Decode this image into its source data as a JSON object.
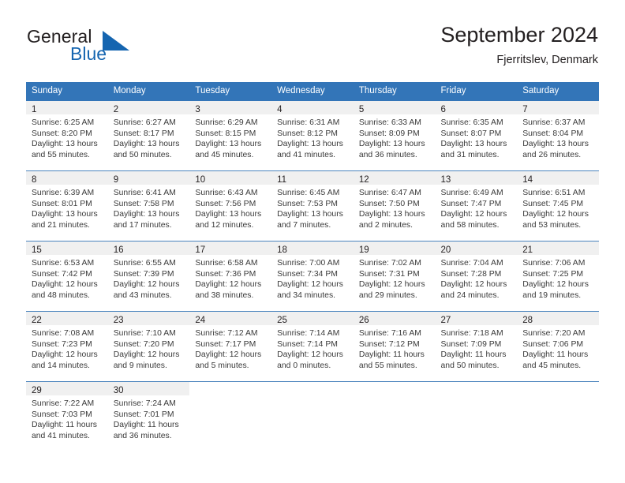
{
  "brand": {
    "word1": "General",
    "word2": "Blue",
    "triangle_color": "#1565b0",
    "icon": "blue-triangle-icon"
  },
  "header": {
    "title": "September 2024",
    "location": "Fjerritslev, Denmark"
  },
  "theme": {
    "header_blue": "#3375b8",
    "row_divider": "#4a84bd",
    "daynum_band": "#f0f0f0",
    "text": "#231f20"
  },
  "calendar": {
    "weekday_headers": [
      "Sunday",
      "Monday",
      "Tuesday",
      "Wednesday",
      "Thursday",
      "Friday",
      "Saturday"
    ],
    "labels": {
      "sunrise": "Sunrise:",
      "sunset": "Sunset:",
      "daylight": "Daylight:"
    },
    "weeks": [
      [
        {
          "day": "1",
          "sunrise": "Sunrise: 6:25 AM",
          "sunset": "Sunset: 8:20 PM",
          "daylight_1": "Daylight: 13 hours",
          "daylight_2": "and 55 minutes."
        },
        {
          "day": "2",
          "sunrise": "Sunrise: 6:27 AM",
          "sunset": "Sunset: 8:17 PM",
          "daylight_1": "Daylight: 13 hours",
          "daylight_2": "and 50 minutes."
        },
        {
          "day": "3",
          "sunrise": "Sunrise: 6:29 AM",
          "sunset": "Sunset: 8:15 PM",
          "daylight_1": "Daylight: 13 hours",
          "daylight_2": "and 45 minutes."
        },
        {
          "day": "4",
          "sunrise": "Sunrise: 6:31 AM",
          "sunset": "Sunset: 8:12 PM",
          "daylight_1": "Daylight: 13 hours",
          "daylight_2": "and 41 minutes."
        },
        {
          "day": "5",
          "sunrise": "Sunrise: 6:33 AM",
          "sunset": "Sunset: 8:09 PM",
          "daylight_1": "Daylight: 13 hours",
          "daylight_2": "and 36 minutes."
        },
        {
          "day": "6",
          "sunrise": "Sunrise: 6:35 AM",
          "sunset": "Sunset: 8:07 PM",
          "daylight_1": "Daylight: 13 hours",
          "daylight_2": "and 31 minutes."
        },
        {
          "day": "7",
          "sunrise": "Sunrise: 6:37 AM",
          "sunset": "Sunset: 8:04 PM",
          "daylight_1": "Daylight: 13 hours",
          "daylight_2": "and 26 minutes."
        }
      ],
      [
        {
          "day": "8",
          "sunrise": "Sunrise: 6:39 AM",
          "sunset": "Sunset: 8:01 PM",
          "daylight_1": "Daylight: 13 hours",
          "daylight_2": "and 21 minutes."
        },
        {
          "day": "9",
          "sunrise": "Sunrise: 6:41 AM",
          "sunset": "Sunset: 7:58 PM",
          "daylight_1": "Daylight: 13 hours",
          "daylight_2": "and 17 minutes."
        },
        {
          "day": "10",
          "sunrise": "Sunrise: 6:43 AM",
          "sunset": "Sunset: 7:56 PM",
          "daylight_1": "Daylight: 13 hours",
          "daylight_2": "and 12 minutes."
        },
        {
          "day": "11",
          "sunrise": "Sunrise: 6:45 AM",
          "sunset": "Sunset: 7:53 PM",
          "daylight_1": "Daylight: 13 hours",
          "daylight_2": "and 7 minutes."
        },
        {
          "day": "12",
          "sunrise": "Sunrise: 6:47 AM",
          "sunset": "Sunset: 7:50 PM",
          "daylight_1": "Daylight: 13 hours",
          "daylight_2": "and 2 minutes."
        },
        {
          "day": "13",
          "sunrise": "Sunrise: 6:49 AM",
          "sunset": "Sunset: 7:47 PM",
          "daylight_1": "Daylight: 12 hours",
          "daylight_2": "and 58 minutes."
        },
        {
          "day": "14",
          "sunrise": "Sunrise: 6:51 AM",
          "sunset": "Sunset: 7:45 PM",
          "daylight_1": "Daylight: 12 hours",
          "daylight_2": "and 53 minutes."
        }
      ],
      [
        {
          "day": "15",
          "sunrise": "Sunrise: 6:53 AM",
          "sunset": "Sunset: 7:42 PM",
          "daylight_1": "Daylight: 12 hours",
          "daylight_2": "and 48 minutes."
        },
        {
          "day": "16",
          "sunrise": "Sunrise: 6:55 AM",
          "sunset": "Sunset: 7:39 PM",
          "daylight_1": "Daylight: 12 hours",
          "daylight_2": "and 43 minutes."
        },
        {
          "day": "17",
          "sunrise": "Sunrise: 6:58 AM",
          "sunset": "Sunset: 7:36 PM",
          "daylight_1": "Daylight: 12 hours",
          "daylight_2": "and 38 minutes."
        },
        {
          "day": "18",
          "sunrise": "Sunrise: 7:00 AM",
          "sunset": "Sunset: 7:34 PM",
          "daylight_1": "Daylight: 12 hours",
          "daylight_2": "and 34 minutes."
        },
        {
          "day": "19",
          "sunrise": "Sunrise: 7:02 AM",
          "sunset": "Sunset: 7:31 PM",
          "daylight_1": "Daylight: 12 hours",
          "daylight_2": "and 29 minutes."
        },
        {
          "day": "20",
          "sunrise": "Sunrise: 7:04 AM",
          "sunset": "Sunset: 7:28 PM",
          "daylight_1": "Daylight: 12 hours",
          "daylight_2": "and 24 minutes."
        },
        {
          "day": "21",
          "sunrise": "Sunrise: 7:06 AM",
          "sunset": "Sunset: 7:25 PM",
          "daylight_1": "Daylight: 12 hours",
          "daylight_2": "and 19 minutes."
        }
      ],
      [
        {
          "day": "22",
          "sunrise": "Sunrise: 7:08 AM",
          "sunset": "Sunset: 7:23 PM",
          "daylight_1": "Daylight: 12 hours",
          "daylight_2": "and 14 minutes."
        },
        {
          "day": "23",
          "sunrise": "Sunrise: 7:10 AM",
          "sunset": "Sunset: 7:20 PM",
          "daylight_1": "Daylight: 12 hours",
          "daylight_2": "and 9 minutes."
        },
        {
          "day": "24",
          "sunrise": "Sunrise: 7:12 AM",
          "sunset": "Sunset: 7:17 PM",
          "daylight_1": "Daylight: 12 hours",
          "daylight_2": "and 5 minutes."
        },
        {
          "day": "25",
          "sunrise": "Sunrise: 7:14 AM",
          "sunset": "Sunset: 7:14 PM",
          "daylight_1": "Daylight: 12 hours",
          "daylight_2": "and 0 minutes."
        },
        {
          "day": "26",
          "sunrise": "Sunrise: 7:16 AM",
          "sunset": "Sunset: 7:12 PM",
          "daylight_1": "Daylight: 11 hours",
          "daylight_2": "and 55 minutes."
        },
        {
          "day": "27",
          "sunrise": "Sunrise: 7:18 AM",
          "sunset": "Sunset: 7:09 PM",
          "daylight_1": "Daylight: 11 hours",
          "daylight_2": "and 50 minutes."
        },
        {
          "day": "28",
          "sunrise": "Sunrise: 7:20 AM",
          "sunset": "Sunset: 7:06 PM",
          "daylight_1": "Daylight: 11 hours",
          "daylight_2": "and 45 minutes."
        }
      ],
      [
        {
          "day": "29",
          "sunrise": "Sunrise: 7:22 AM",
          "sunset": "Sunset: 7:03 PM",
          "daylight_1": "Daylight: 11 hours",
          "daylight_2": "and 41 minutes."
        },
        {
          "day": "30",
          "sunrise": "Sunrise: 7:24 AM",
          "sunset": "Sunset: 7:01 PM",
          "daylight_1": "Daylight: 11 hours",
          "daylight_2": "and 36 minutes."
        },
        {
          "day": "",
          "sunrise": "",
          "sunset": "",
          "daylight_1": "",
          "daylight_2": ""
        },
        {
          "day": "",
          "sunrise": "",
          "sunset": "",
          "daylight_1": "",
          "daylight_2": ""
        },
        {
          "day": "",
          "sunrise": "",
          "sunset": "",
          "daylight_1": "",
          "daylight_2": ""
        },
        {
          "day": "",
          "sunrise": "",
          "sunset": "",
          "daylight_1": "",
          "daylight_2": ""
        },
        {
          "day": "",
          "sunrise": "",
          "sunset": "",
          "daylight_1": "",
          "daylight_2": ""
        }
      ]
    ]
  }
}
